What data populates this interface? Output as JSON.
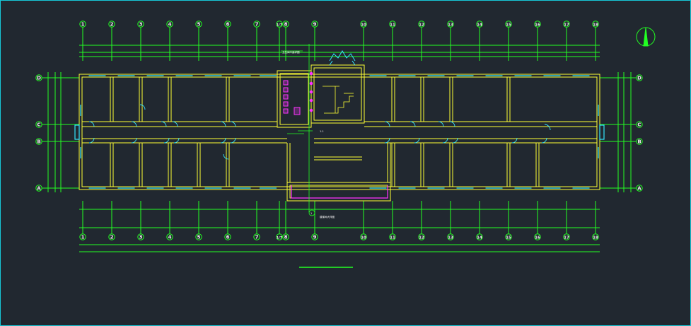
{
  "colors": {
    "background": "#212830",
    "frame": "#17c8d8",
    "grid": "#22ff22",
    "wall": "#ffff33",
    "window": "#33e5ff",
    "accent": "#ff33ff",
    "text": "#ffffff"
  },
  "axes_columns": [
    "1",
    "2",
    "3",
    "4",
    "5",
    "6",
    "7",
    "1/7",
    "8",
    "9",
    "10",
    "11",
    "12",
    "13",
    "14",
    "15",
    "16",
    "17",
    "18"
  ],
  "axes_rows": [
    "D",
    "C",
    "B",
    "A"
  ],
  "labels": {
    "stair_mark": "1-1",
    "section_note": "卫生间平面详图",
    "detail_mark": "1",
    "detail_caption": "楼梯间大样图"
  },
  "north_arrow": "north-arrow-icon"
}
